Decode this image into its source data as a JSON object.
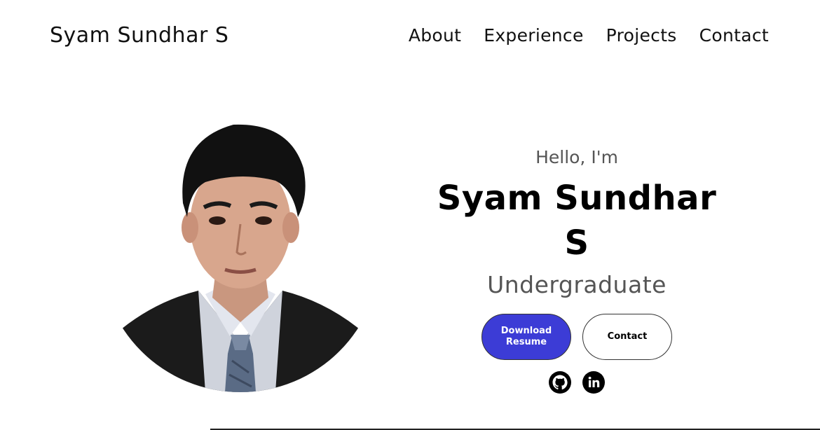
{
  "nav": {
    "brand": "Syam Sundhar S",
    "links": [
      {
        "label": "About"
      },
      {
        "label": "Experience"
      },
      {
        "label": "Projects"
      },
      {
        "label": "Contact"
      }
    ]
  },
  "hero": {
    "greeting": "Hello, I'm",
    "name": "Syam Sundhar S",
    "role": "Undergraduate",
    "buttons": {
      "download_resume": "Download Resume",
      "contact": "Contact"
    },
    "socials": [
      {
        "icon": "github-icon"
      },
      {
        "icon": "linkedin-icon"
      }
    ]
  },
  "colors": {
    "primary_button": "#3c3cd6",
    "text": "#000000",
    "muted_text": "#555555",
    "background": "#ffffff"
  }
}
